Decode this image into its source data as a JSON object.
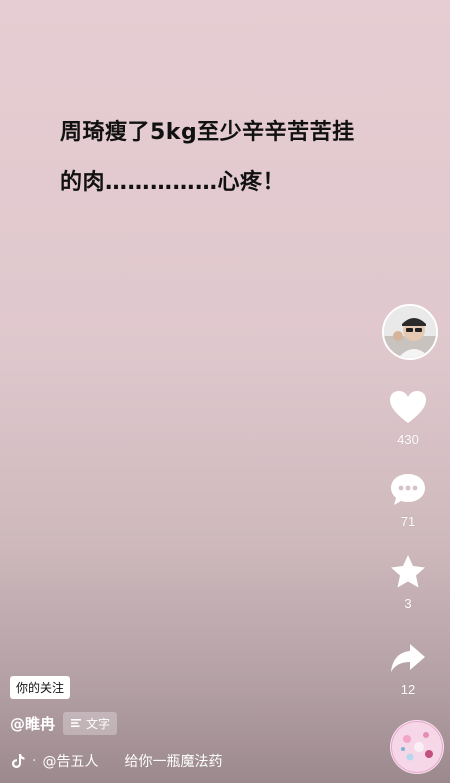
{
  "post": {
    "line1": "周琦瘦了5kg至少辛辛苦苦挂",
    "line2": "的肉……………心疼！"
  },
  "actions": {
    "like_count": "430",
    "comment_count": "71",
    "favorite_count": "3",
    "share_count": "12"
  },
  "footer": {
    "follow_chip": "你的关注",
    "author": "@睢冉",
    "text_badge": "文字",
    "music": "@告五人",
    "song": "给你一瓶魔法药"
  },
  "colors": {
    "icon": "#ffffff",
    "text_dark": "#111111"
  }
}
